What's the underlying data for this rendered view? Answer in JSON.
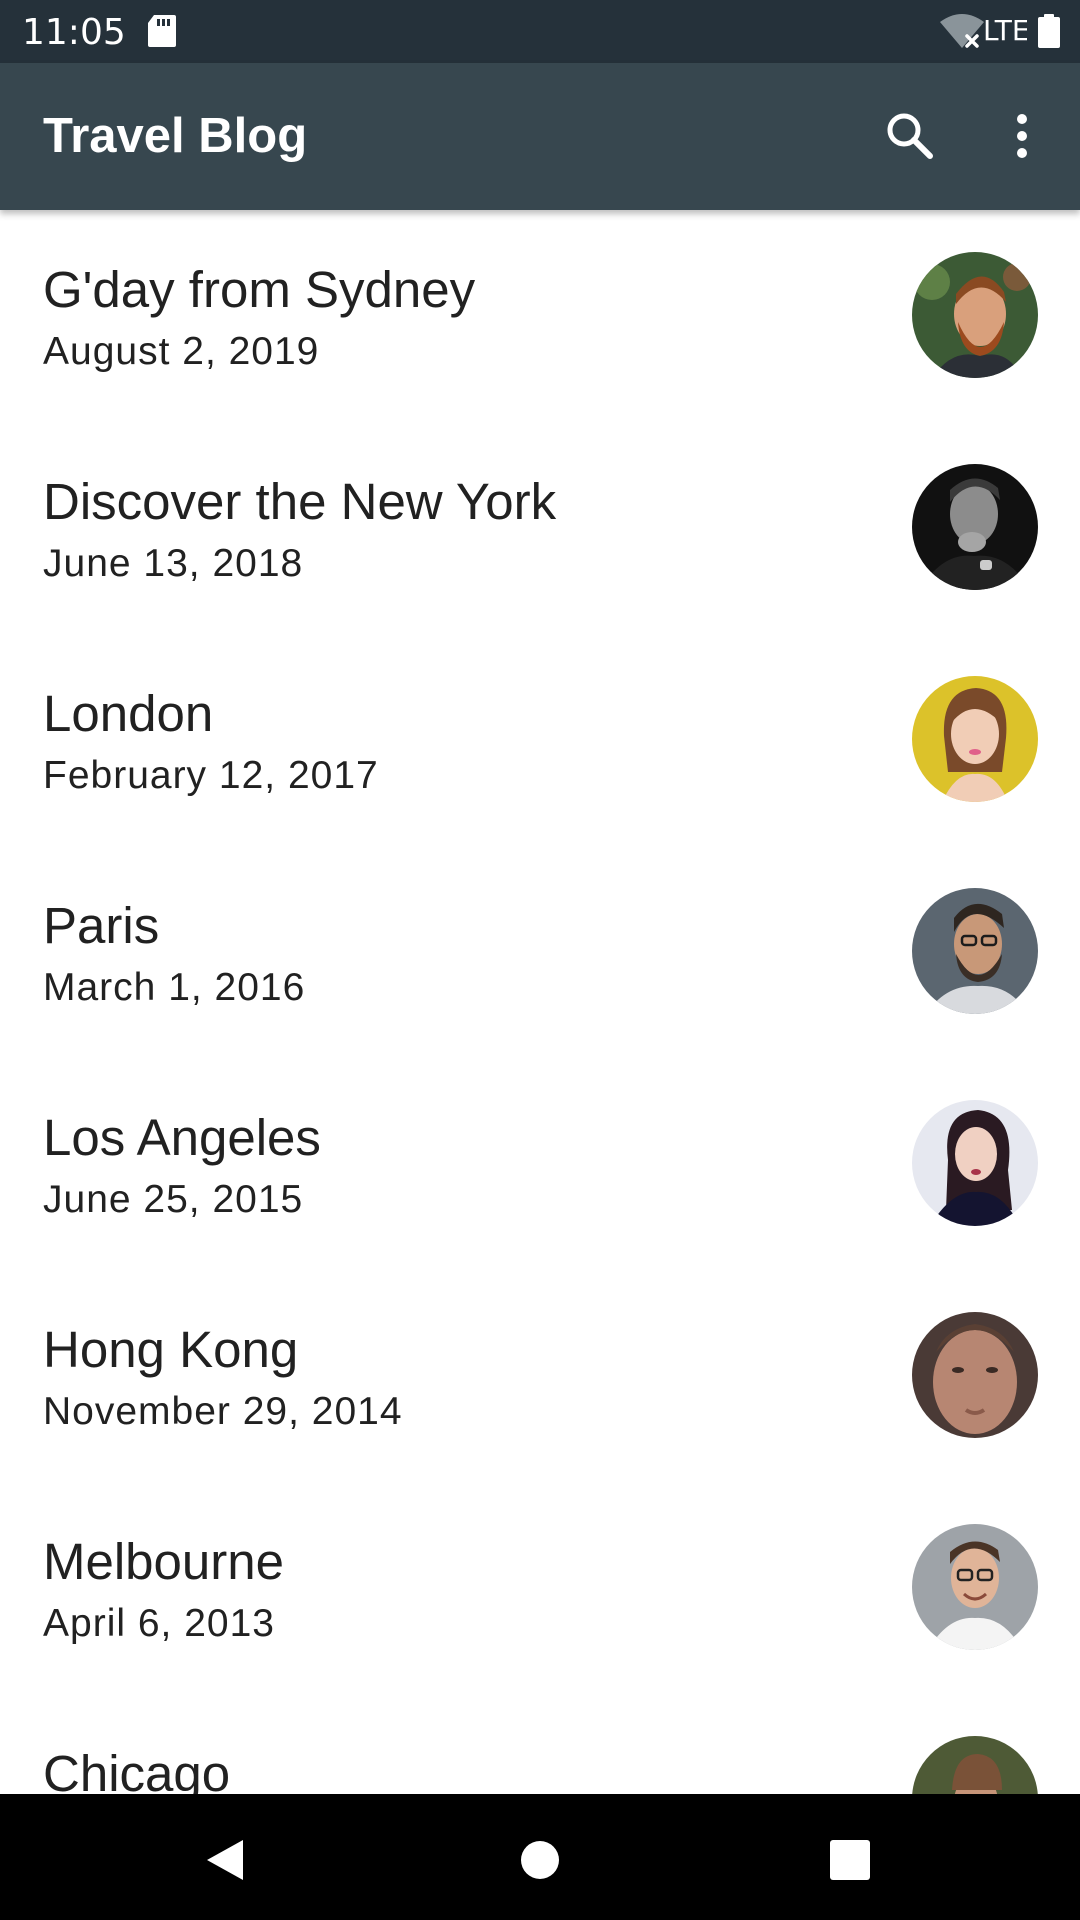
{
  "status_bar": {
    "time": "11:05",
    "network_label": "LTE",
    "icons": [
      "sd-card-icon",
      "wifi-off-icon",
      "battery-icon"
    ]
  },
  "app_bar": {
    "title": "Travel Blog",
    "actions": [
      "search-icon",
      "more-vert-icon"
    ],
    "color": "#37474f"
  },
  "posts": [
    {
      "title": "G'day from Sydney",
      "date": "August 2, 2019",
      "avatar": "bearded-man-avatar"
    },
    {
      "title": "Discover the New York",
      "date": "June 13, 2018",
      "avatar": "bw-man-avatar"
    },
    {
      "title": "London",
      "date": "February 12, 2017",
      "avatar": "woman-yellow-bg-avatar"
    },
    {
      "title": "Paris",
      "date": "March 1, 2016",
      "avatar": "man-glasses-beard-avatar"
    },
    {
      "title": "Los Angeles",
      "date": "June 25, 2015",
      "avatar": "woman-dark-hair-avatar"
    },
    {
      "title": "Hong Kong",
      "date": "November 29, 2014",
      "avatar": "man-closeup-avatar"
    },
    {
      "title": "Melbourne",
      "date": "April 6, 2013",
      "avatar": "smiling-man-glasses-avatar"
    },
    {
      "title": "Chicago",
      "date": "",
      "avatar": "man-beanie-avatar"
    }
  ],
  "nav_bar": {
    "buttons": [
      "back-icon",
      "home-icon",
      "recents-icon"
    ]
  }
}
